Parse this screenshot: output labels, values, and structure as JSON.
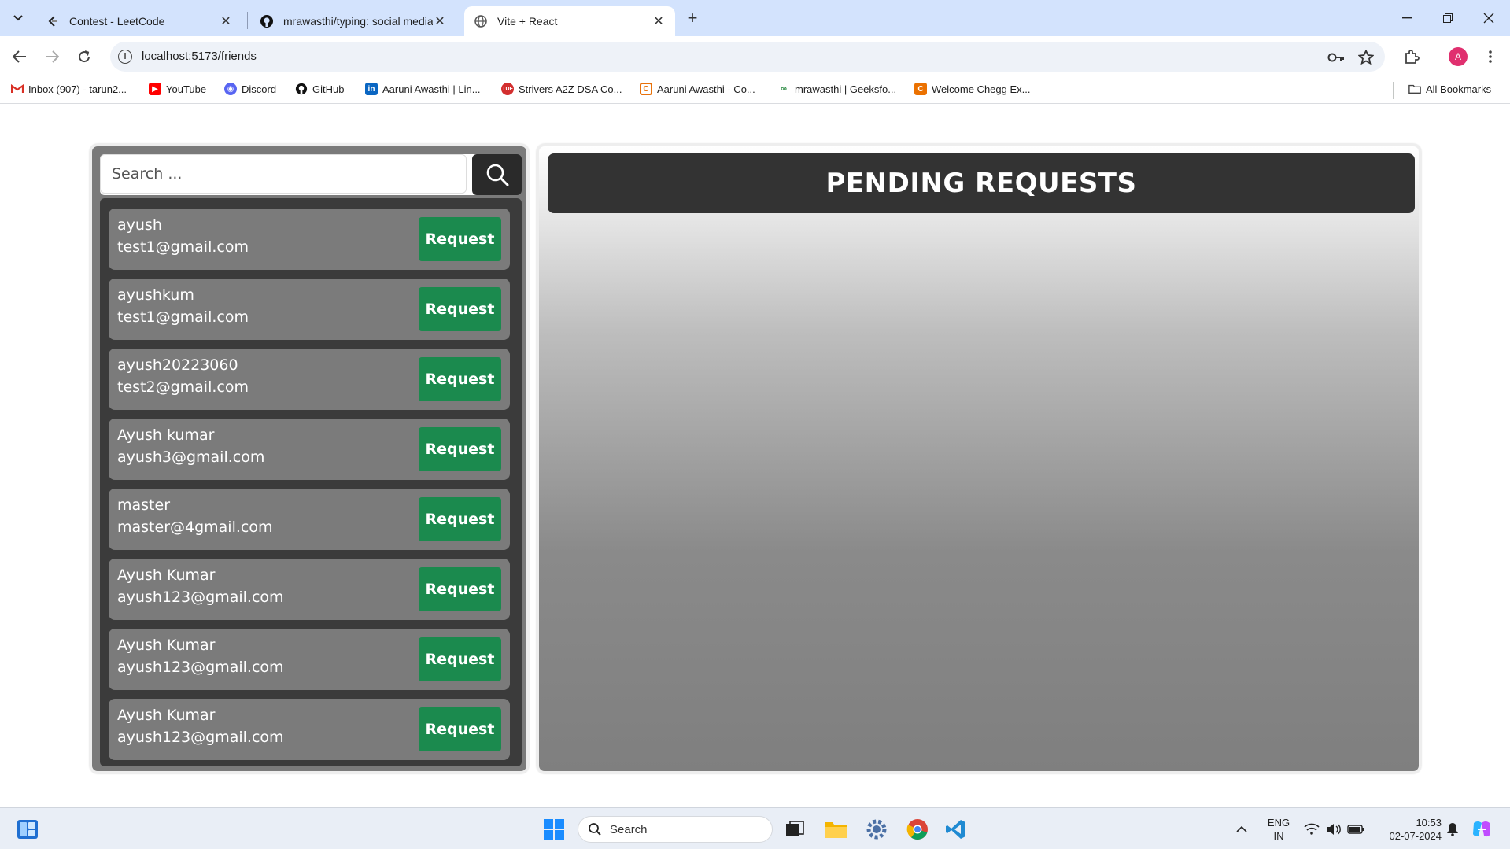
{
  "browser": {
    "tabs": [
      {
        "title": "Contest - LeetCode",
        "icon": "leetcode-icon",
        "active": false
      },
      {
        "title": "mrawasthi/typing: social media",
        "icon": "github-icon",
        "active": false
      },
      {
        "title": "Vite + React",
        "icon": "globe-icon",
        "active": true
      }
    ],
    "url": "localhost:5173/friends",
    "profile_initial": "A",
    "bookmarks": [
      {
        "label": "Inbox (907) - tarun2...",
        "icon": "gmail-icon"
      },
      {
        "label": "YouTube",
        "icon": "youtube-icon"
      },
      {
        "label": "Discord",
        "icon": "discord-icon"
      },
      {
        "label": "GitHub",
        "icon": "github-icon"
      },
      {
        "label": "Aaruni Awasthi | Lin...",
        "icon": "linkedin-icon"
      },
      {
        "label": "Strivers A2Z DSA Co...",
        "icon": "tuf-icon"
      },
      {
        "label": "Aaruni Awasthi - Co...",
        "icon": "codechef-icon"
      },
      {
        "label": "mrawasthi | Geeksfo...",
        "icon": "gfg-icon"
      },
      {
        "label": "Welcome Chegg Ex...",
        "icon": "chegg-icon"
      }
    ],
    "all_bookmarks": "All Bookmarks"
  },
  "search": {
    "placeholder": "Search ..."
  },
  "users": [
    {
      "name": "ayush",
      "email": "test1@gmail.com",
      "button": "Request"
    },
    {
      "name": "ayushkum",
      "email": "test1@gmail.com",
      "button": "Request"
    },
    {
      "name": "ayush20223060",
      "email": "test2@gmail.com",
      "button": "Request"
    },
    {
      "name": "Ayush kumar",
      "email": "ayush3@gmail.com",
      "button": "Request"
    },
    {
      "name": "master",
      "email": "master@4gmail.com",
      "button": "Request"
    },
    {
      "name": "Ayush Kumar",
      "email": "ayush123@gmail.com",
      "button": "Request"
    },
    {
      "name": "Ayush Kumar",
      "email": "ayush123@gmail.com",
      "button": "Request"
    },
    {
      "name": "Ayush Kumar",
      "email": "ayush123@gmail.com",
      "button": "Request"
    }
  ],
  "pending": {
    "title": "PENDING REQUESTS"
  },
  "taskbar": {
    "search_label": "Search",
    "lang_top": "ENG",
    "lang_bottom": "IN",
    "time": "10:53",
    "date": "02-07-2024"
  },
  "colors": {
    "request_button": "#1b8a4e",
    "header_bg": "#333333",
    "tabstrip": "#d3e3fd"
  }
}
